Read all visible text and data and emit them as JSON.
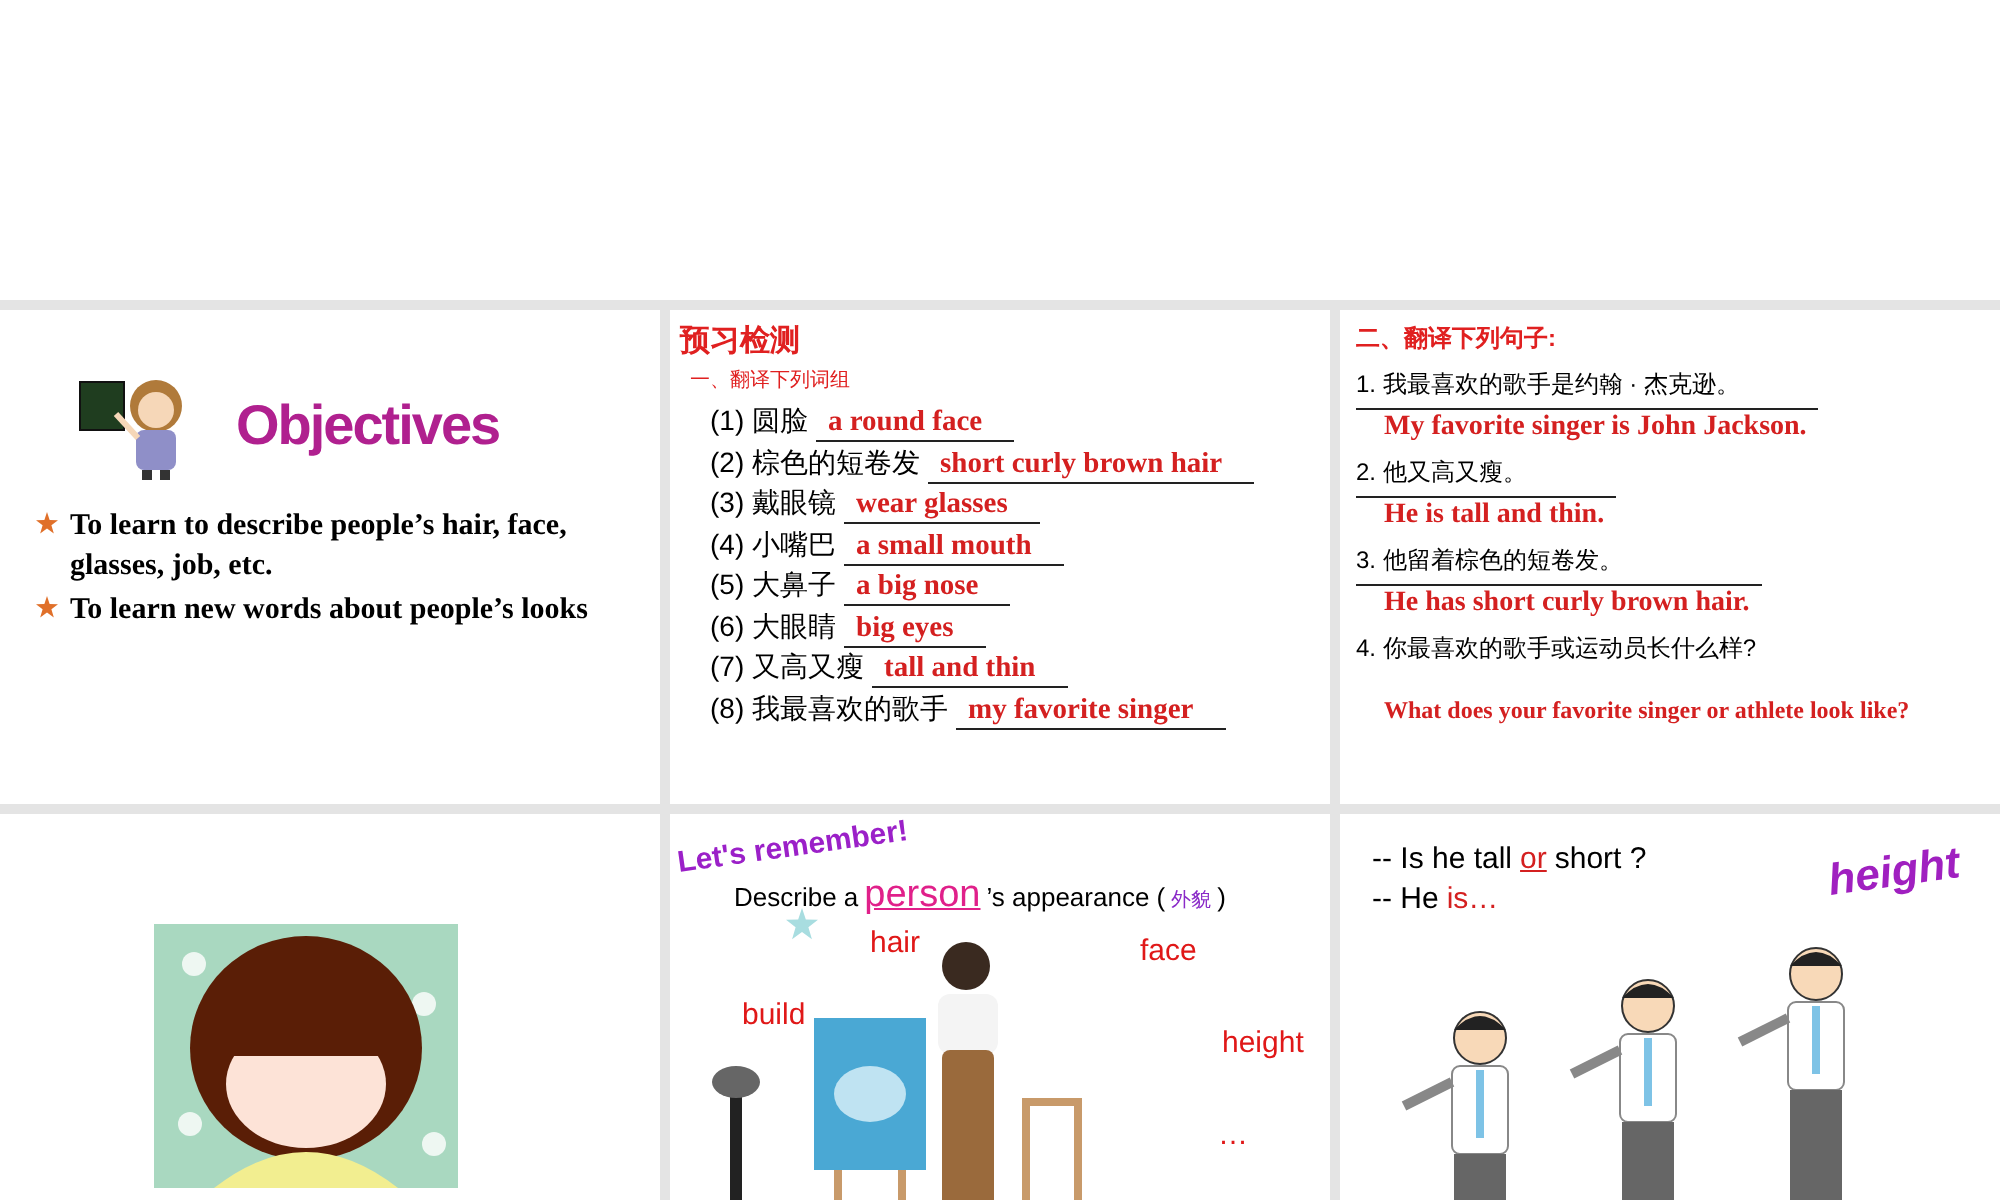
{
  "slides": [
    {
      "kind": "objectives",
      "title": "Objectives",
      "bullets": [
        "To learn to describe people’s hair, face, glasses, job, etc.",
        "To learn new words about people’s looks"
      ]
    },
    {
      "kind": "phrases",
      "title": "预习检测",
      "subtitle": "一、翻译下列词组",
      "items": [
        {
          "number": "(1)",
          "prompt": "圆脸",
          "answer": "a round face"
        },
        {
          "number": "(2)",
          "prompt": "棕色的短卷发",
          "answer": "short curly brown hair"
        },
        {
          "number": "(3)",
          "prompt": "戴眼镜",
          "answer": "wear glasses"
        },
        {
          "number": "(4)",
          "prompt": "小嘴巴",
          "answer": "a small mouth"
        },
        {
          "number": "(5)",
          "prompt": "大鼻子",
          "answer": "a big nose"
        },
        {
          "number": "(6)",
          "prompt": "大眼睛",
          "answer": "big eyes"
        },
        {
          "number": "(7)",
          "prompt": "又高又瘦",
          "answer": "tall and thin"
        },
        {
          "number": "(8)",
          "prompt": "我最喜欢的歌手",
          "answer": "my favorite singer"
        }
      ]
    },
    {
      "kind": "sentences",
      "title": "二、翻译下列句子:",
      "items": [
        {
          "prompt": "1. 我最喜欢的歌手是约翰 · 杰克逊。",
          "answer": "My favorite singer is John Jackson."
        },
        {
          "prompt": "2. 他又高又瘦。",
          "answer": "He is tall and thin."
        },
        {
          "prompt": "3. 他留着棕色的短卷发。",
          "answer": "He has short curly brown hair."
        },
        {
          "prompt": "4. 你最喜欢的歌手或运动员长什么样?",
          "answer": "What does your favorite singer or athlete look like?"
        }
      ]
    },
    {
      "kind": "cartoon"
    },
    {
      "kind": "appearance",
      "banner": "Let's remember!",
      "heading_start": "Describe a",
      "keyword": "person",
      "heading_end": "’s appearance (",
      "note": "外貌",
      "heading_close": ")",
      "words": [
        "hair",
        "face",
        "build",
        "height",
        "…"
      ]
    },
    {
      "kind": "height",
      "question_start": "-- Is he tall",
      "question_key": "or",
      "question_end": "short ?",
      "answer_start": "-- He",
      "answer_key": "is…",
      "word": "height"
    }
  ]
}
